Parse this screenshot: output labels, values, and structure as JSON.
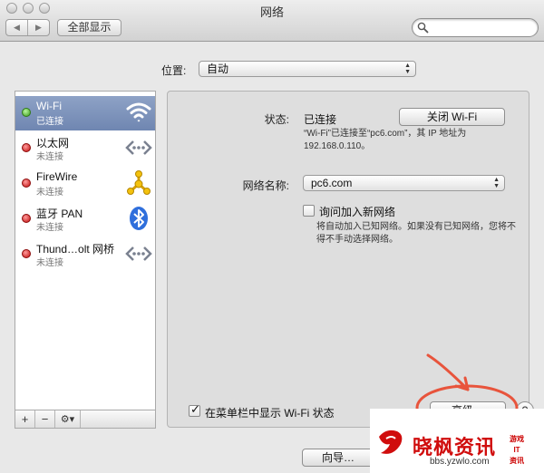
{
  "window": {
    "title": "网络",
    "back_icon": "◀",
    "forward_icon": "▶",
    "show_all": "全部显示",
    "search_placeholder": ""
  },
  "location": {
    "label": "位置:",
    "value": "自动"
  },
  "services": [
    {
      "name": "Wi-Fi",
      "status": "已连接",
      "status_color": "green",
      "icon": "wifi-icon",
      "selected": true
    },
    {
      "name": "以太网",
      "status": "未连接",
      "status_color": "red",
      "icon": "ethernet-icon",
      "selected": false
    },
    {
      "name": "FireWire",
      "status": "未连接",
      "status_color": "red",
      "icon": "firewire-icon",
      "selected": false
    },
    {
      "name": "蓝牙 PAN",
      "status": "未连接",
      "status_color": "red",
      "icon": "bluetooth-icon",
      "selected": false
    },
    {
      "name": "Thund…olt 网桥",
      "status": "未连接",
      "status_color": "red",
      "icon": "thunderbolt-bridge-icon",
      "selected": false
    }
  ],
  "sidebar_footer": {
    "add": "+",
    "remove": "−",
    "actions": "⚙▾"
  },
  "details": {
    "status_label": "状态:",
    "status_value": "已连接",
    "turn_off_button": "关闭 Wi-Fi",
    "status_desc_line1": "“Wi-Fi”已连接至“pc6.com”，其 IP 地址为",
    "status_desc_line2": "192.168.0.110。",
    "network_name_label": "网络名称:",
    "network_name_value": "pc6.com",
    "ask_join_label": "询问加入新网络",
    "ask_join_checked": false,
    "ask_join_desc_line1": "将自动加入已知网络。如果没有已知网络，您将不",
    "ask_join_desc_line2": "得不手动选择网络。",
    "show_menubar_label": "在菜单栏中显示 Wi-Fi 状态",
    "show_menubar_checked": true,
    "advanced_button": "高级…",
    "help_button": "?"
  },
  "bottom": {
    "assistant_button": "向导…"
  },
  "watermark": {
    "main": "晓枫资讯",
    "url": "bbs.yzwlo.com",
    "side_line1": "游戏",
    "side_line2": "IT",
    "side_line3": "资讯"
  },
  "colors": {
    "selection": "#7a8fb9",
    "annotation_arrow": "#e8543c",
    "watermark_red": "#d00d0d"
  }
}
